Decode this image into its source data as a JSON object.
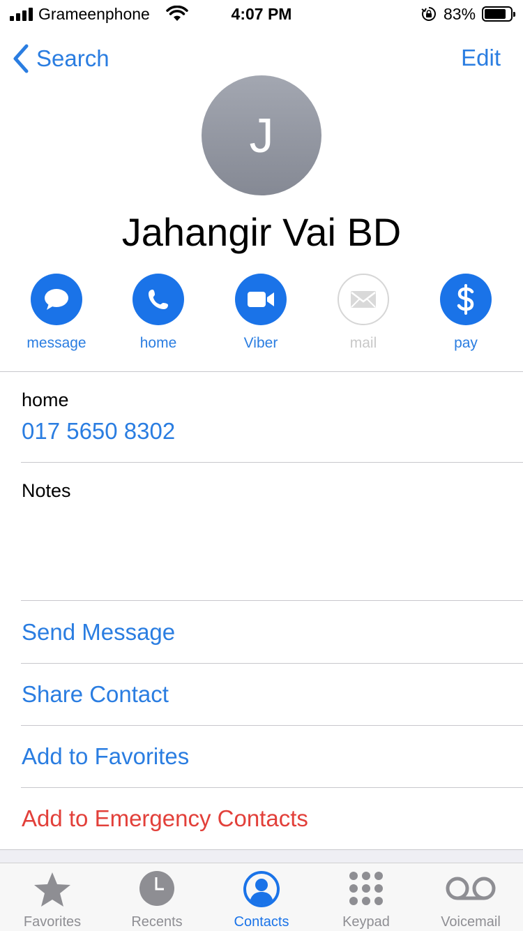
{
  "status_bar": {
    "carrier": "Grameenphone",
    "time": "4:07 PM",
    "battery_percent": "83%"
  },
  "nav": {
    "back_label": "Search",
    "edit_label": "Edit"
  },
  "contact": {
    "initial": "J",
    "name": "Jahangir Vai BD"
  },
  "actions": [
    {
      "label": "message",
      "icon": "message-bubble-icon",
      "enabled": true
    },
    {
      "label": "home",
      "icon": "phone-icon",
      "enabled": true
    },
    {
      "label": "Viber",
      "icon": "video-camera-icon",
      "enabled": true
    },
    {
      "label": "mail",
      "icon": "envelope-icon",
      "enabled": false
    },
    {
      "label": "pay",
      "icon": "dollar-icon",
      "enabled": true
    }
  ],
  "phone": {
    "label": "home",
    "number": "017 5650 8302"
  },
  "notes": {
    "label": "Notes"
  },
  "rows": {
    "send_message": "Send Message",
    "share_contact": "Share Contact",
    "add_favorites": "Add to Favorites",
    "add_emergency": "Add to Emergency Contacts"
  },
  "tabs": [
    {
      "label": "Favorites",
      "icon": "star-icon",
      "active": false
    },
    {
      "label": "Recents",
      "icon": "clock-icon",
      "active": false
    },
    {
      "label": "Contacts",
      "icon": "person-circle-icon",
      "active": true
    },
    {
      "label": "Keypad",
      "icon": "keypad-icon",
      "active": false
    },
    {
      "label": "Voicemail",
      "icon": "voicemail-icon",
      "active": false
    }
  ],
  "colors": {
    "accent": "#1a73e8",
    "link": "#2a7de1",
    "destructive": "#e2403a",
    "disabled": "#c8c8c8"
  }
}
